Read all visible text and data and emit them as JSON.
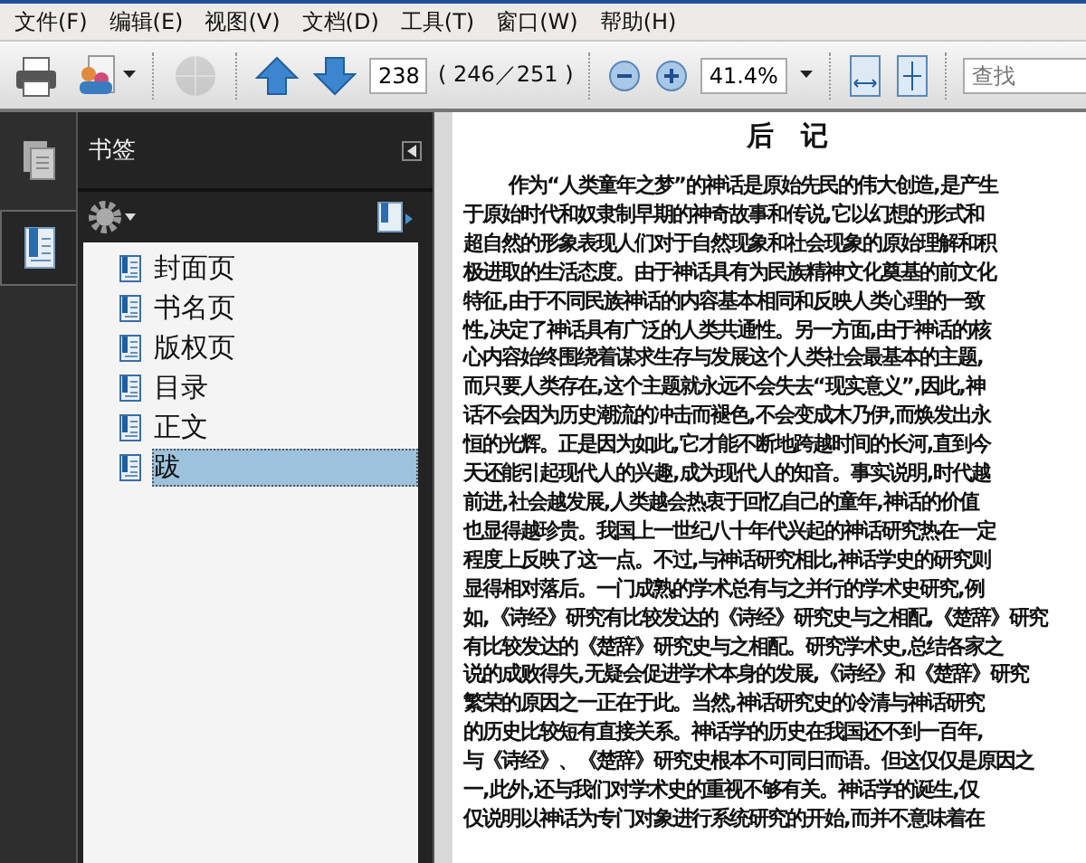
{
  "menu": [
    {
      "label": "文件(F)"
    },
    {
      "label": "编辑(E)"
    },
    {
      "label": "视图(V)"
    },
    {
      "label": "文档(D)"
    },
    {
      "label": "工具(T)"
    },
    {
      "label": "窗口(W)"
    },
    {
      "label": "帮助(H)"
    }
  ],
  "toolbar": {
    "page_field": {
      "value": "238"
    },
    "page_count": "( 246／251 )",
    "zoom_field": {
      "value": "41.4%"
    },
    "search": {
      "placeholder": "查找"
    },
    "share_disabled": true
  },
  "sidebar": {
    "tabs": [
      {
        "kind": "pages",
        "selected": false
      },
      {
        "kind": "bookmarks",
        "selected": true
      }
    ],
    "panel_title": "书签",
    "bookmarks": [
      {
        "label": "封面页",
        "selected": false
      },
      {
        "label": "书名页",
        "selected": false
      },
      {
        "label": "版权页",
        "selected": false
      },
      {
        "label": "目录",
        "selected": false
      },
      {
        "label": "正文",
        "selected": false
      },
      {
        "label": "跋",
        "selected": true
      }
    ]
  },
  "document": {
    "title": "后　记",
    "lines": [
      "作为“人类童年之梦”的神话是原始先民的伟大创造,是产生",
      "于原始时代和奴隶制早期的神奇故事和传说,它以幻想的形式和",
      "超自然的形象表现人们对于自然现象和社会现象的原始理解和积",
      "极进取的生活态度。由于神话具有为民族精神文化奠基的前文化",
      "特征,由于不同民族神话的内容基本相同和反映人类心理的一致",
      "性,决定了神话具有广泛的人类共通性。另一方面,由于神话的核",
      "心内容始终围绕着谋求生存与发展这个人类社会最基本的主题,",
      "而只要人类存在,这个主题就永远不会失去“现实意义”,因此,神",
      "话不会因为历史潮流的冲击而褪色,不会变成木乃伊,而焕发出永",
      "恒的光辉。正是因为如此,它才能不断地跨越时间的长河,直到今",
      "天还能引起现代人的兴趣,成为现代人的知音。事实说明,时代越",
      "前进,社会越发展,人类越会热衷于回忆自己的童年,神话的价值",
      "也显得越珍贵。我国上一世纪八十年代兴起的神话研究热在一定",
      "程度上反映了这一点。不过,与神话研究相比,神话学史的研究则",
      "显得相对落后。一门成熟的学术总有与之并行的学术史研究,例",
      "如,《诗经》研究有比较发达的《诗经》研究史与之相配,《楚辞》研究",
      "有比较发达的《楚辞》研究史与之相配。研究学术史,总结各家之",
      "说的成败得失,无疑会促进学术本身的发展,《诗经》和《楚辞》研究",
      "繁荣的原因之一正在于此。当然,神话研究史的冷清与神话研究",
      "的历史比较短有直接关系。神话学的历史在我国还不到一百年,",
      "与《诗经》、《楚辞》研究史根本不可同日而语。但这仅仅是原因之",
      "一,此外,还与我们对学术史的重视不够有关。神话学的诞生,仅",
      "仅说明以神话为专门对象进行系统研究的开始,而并不意味着在"
    ]
  }
}
